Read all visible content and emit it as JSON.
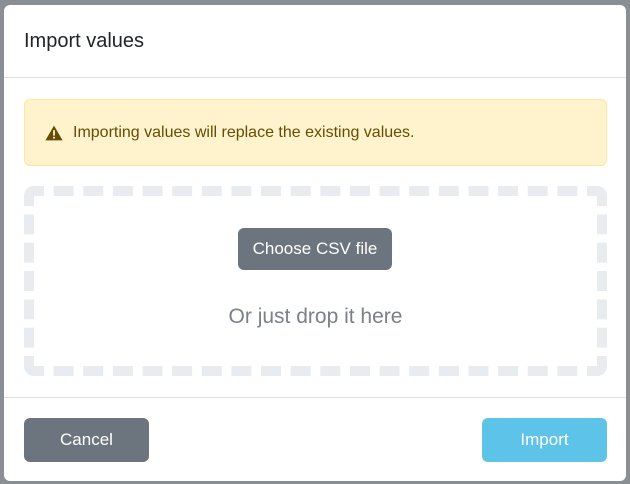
{
  "modal": {
    "title": "Import values"
  },
  "alert": {
    "icon": "warning-triangle-icon",
    "message": "Importing values will replace the existing values."
  },
  "dropzone": {
    "choose_label": "Choose CSV file",
    "drop_text": "Or just drop it here"
  },
  "footer": {
    "cancel_label": "Cancel",
    "import_label": "Import"
  },
  "colors": {
    "secondary": "#6c757d",
    "import_button": "#5ec3e8",
    "alert_background": "#fff3cd",
    "alert_text": "#664d03"
  }
}
